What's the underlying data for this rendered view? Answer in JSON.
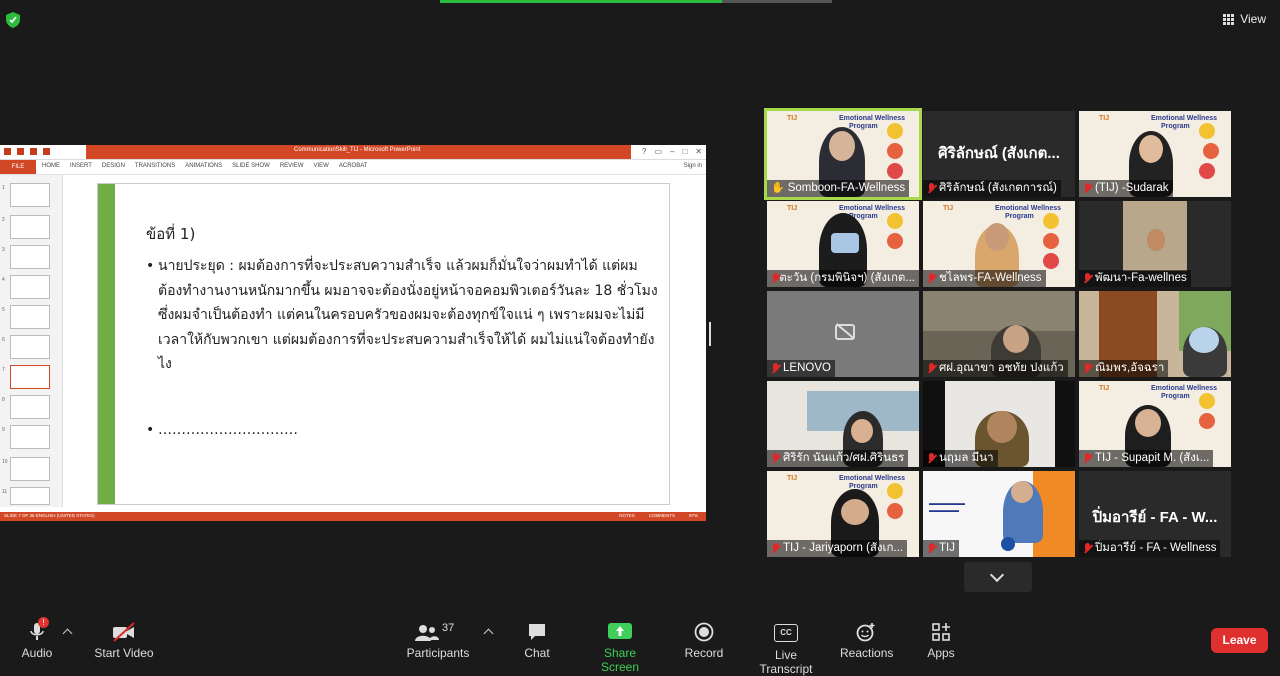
{
  "topbar": {
    "view_label": "View"
  },
  "ppt": {
    "window_title": "CommunicationSkill_TIJ - Microsoft PowerPoint",
    "file_tab": "FILE",
    "tabs": [
      "HOME",
      "INSERT",
      "DESIGN",
      "TRANSITIONS",
      "ANIMATIONS",
      "SLIDE SHOW",
      "REVIEW",
      "VIEW",
      "ACROBAT"
    ],
    "sign_in": "Sign in",
    "thumb_numbers": [
      "1",
      "2",
      "3",
      "4",
      "5",
      "6",
      "7",
      "8",
      "9",
      "10",
      "11"
    ],
    "status_left": "SLIDE 7 OF 36      ENGLISH (UNITED STATES)",
    "status_right": [
      "NOTES",
      "COMMENTS",
      "97%"
    ],
    "slide": {
      "heading": "ข้อที่ 1)",
      "bullet1": "นายประยุด : ผมต้องการที่จะประสบความสำเร็จ แล้วผมก็มั่นใจว่าผมทำได้ แต่ผมต้องทำงานงานหนักมากขึ้น ผมอาจจะต้องนั่งอยู่หน้าจอคอมพิวเตอร์วันละ 18 ชั่วโมง ซึ่งผมจำเป็นต้องทำ แต่คนในครอบครัวของผมจะต้องทุกข์ใจแน่ ๆ เพราะผมจะไม่มีเวลาให้กับพวกเขา แต่ผมต้องการที่จะประสบความสำเร็จให้ได้ ผมไม่แน่ใจต้องทำยังไง",
      "bullet2": "…………………………"
    }
  },
  "poster": {
    "line1": "Emotional Wellness",
    "line2": "Program",
    "logo": "TIJ"
  },
  "participants_tiles": [
    {
      "name": "Somboon-FA-Wellness"
    },
    {
      "name": "ศิริลักษณ์ (สังเกตการณ์)",
      "big": "ศิริลักษณ์ (สังเกต..."
    },
    {
      "name": "(TIJ) -Sudarak"
    },
    {
      "name": "ตะวัน (กรมพินิจฯ) (สังเกต..."
    },
    {
      "name": "ชไลพร-FA-Wellness"
    },
    {
      "name": "พัฒนา-Fa-wellnes"
    },
    {
      "name": "LENOVO"
    },
    {
      "name": "ศฝ.อุณาขา อชทัย ปงแก้ว"
    },
    {
      "name": "ณิมพร,อัจฉรา"
    },
    {
      "name": "ศิริรัก นันแก้ว/ศฝ.ศิรินธร"
    },
    {
      "name": "นฤมล มีนา"
    },
    {
      "name": "TIJ - Supapit M. (สังเ..."
    },
    {
      "name": "TIJ - Jariyaporn (สังเก..."
    },
    {
      "name": "TIJ"
    },
    {
      "name": "ปิ่มอารีย์ - FA - Wellness",
      "big": "ปิ่มอารีย์ - FA - W..."
    }
  ],
  "toolbar": {
    "audio": "Audio",
    "audio_badge": "!",
    "video": "Start Video",
    "participants": "Participants",
    "participants_count": "37",
    "chat": "Chat",
    "share": "Share Screen",
    "record": "Record",
    "transcript": "Live Transcript",
    "transcript_icon": "CC",
    "reactions": "Reactions",
    "apps": "Apps",
    "leave": "Leave"
  },
  "colors": {
    "share_green": "#3fcf59",
    "leave_red": "#e02f2f",
    "ppt_orange": "#d24726",
    "slide_green": "#71ad47",
    "active_speaker": "#a8d94d"
  }
}
